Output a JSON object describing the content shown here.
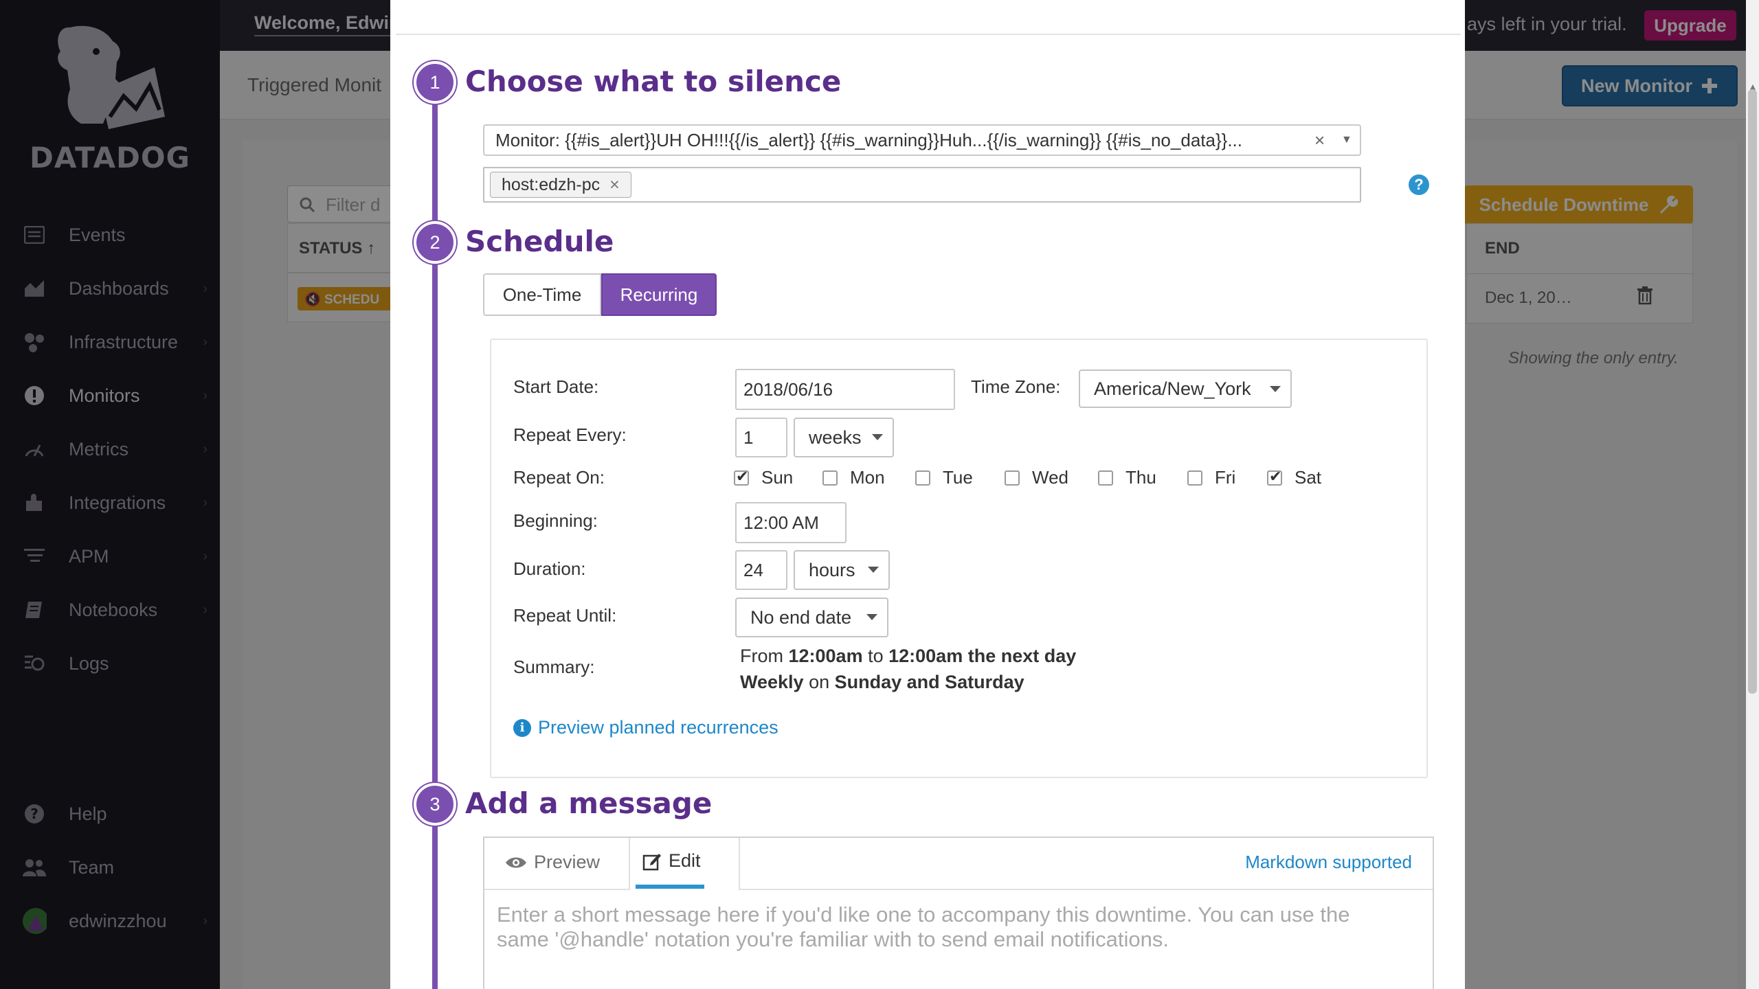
{
  "app": {
    "brand": "DATADOG",
    "welcome": "Welcome, Edwin",
    "trial_text": "ays left in your trial.",
    "upgrade_label": "Upgrade"
  },
  "sidebar": {
    "items": [
      {
        "label": "Events",
        "icon": "events-icon"
      },
      {
        "label": "Dashboards",
        "icon": "dashboards-icon",
        "chevron": "›"
      },
      {
        "label": "Infrastructure",
        "icon": "infrastructure-icon",
        "chevron": "›"
      },
      {
        "label": "Monitors",
        "icon": "monitors-icon",
        "chevron": "›"
      },
      {
        "label": "Metrics",
        "icon": "metrics-icon",
        "chevron": "›"
      },
      {
        "label": "Integrations",
        "icon": "integrations-icon",
        "chevron": "›"
      },
      {
        "label": "APM",
        "icon": "apm-icon",
        "chevron": "›"
      },
      {
        "label": "Notebooks",
        "icon": "notebooks-icon",
        "chevron": "›"
      },
      {
        "label": "Logs",
        "icon": "logs-icon"
      }
    ],
    "bottom": [
      {
        "label": "Help",
        "icon": "help-icon"
      },
      {
        "label": "Team",
        "icon": "team-icon"
      },
      {
        "label": "edwinzzhou",
        "icon": "avatar",
        "chevron": "›"
      }
    ]
  },
  "background_page": {
    "breadcrumb": "Triggered Monit",
    "new_monitor_label": "New Monitor",
    "filter_placeholder": "Filter d",
    "status_header": "STATUS",
    "status_sort": "↑",
    "status_pill": "SCHEDU",
    "schedule_downtime_label": "Schedule Downtime",
    "end_header": "END",
    "end_value": "Dec 1, 20…",
    "only_entry": "Showing the only entry."
  },
  "modal": {
    "steps": [
      {
        "number": "1",
        "title": "Choose what to silence"
      },
      {
        "number": "2",
        "title": "Schedule"
      },
      {
        "number": "3",
        "title": "Add a message"
      }
    ],
    "monitor_select": "Monitor: {{#is_alert}}UH OH!!!{{/is_alert}} {{#is_warning}}Huh...{{/is_warning}} {{#is_no_data}}...",
    "clear_symbol": "×",
    "tags": [
      "host:edzh-pc"
    ],
    "tag_remove": "×",
    "help_symbol": "?",
    "schedule_tabs": {
      "one_time": "One-Time",
      "recurring": "Recurring"
    },
    "form": {
      "start_date_label": "Start Date:",
      "start_date_value": "2018/06/16",
      "timezone_label": "Time Zone:",
      "timezone_value": "America/New_York",
      "repeat_every_label": "Repeat Every:",
      "repeat_every_value": "1",
      "repeat_every_unit": "weeks",
      "repeat_on_label": "Repeat On:",
      "days": [
        {
          "label": "Sun",
          "checked": true
        },
        {
          "label": "Mon",
          "checked": false
        },
        {
          "label": "Tue",
          "checked": false
        },
        {
          "label": "Wed",
          "checked": false
        },
        {
          "label": "Thu",
          "checked": false
        },
        {
          "label": "Fri",
          "checked": false
        },
        {
          "label": "Sat",
          "checked": true
        }
      ],
      "beginning_label": "Beginning:",
      "beginning_value": "12:00 AM",
      "duration_label": "Duration:",
      "duration_value": "24",
      "duration_unit": "hours",
      "repeat_until_label": "Repeat Until:",
      "repeat_until_value": "No end date",
      "summary_label": "Summary:",
      "summary_line1": {
        "pre": "From ",
        "start": "12:00am",
        "mid": " to ",
        "end": "12:00am the next day"
      },
      "summary_line2": {
        "freq": "Weekly",
        "mid": " on ",
        "days": "Sunday and Saturday"
      },
      "preview_link": "Preview planned recurrences",
      "info_symbol": "i"
    },
    "message": {
      "preview_tab": "Preview",
      "edit_tab": "Edit",
      "markdown_link": "Markdown supported",
      "placeholder": "Enter a short message here if you'd like one to accompany this downtime. You can use the same '@handle' notation you're familiar with to send email notifications."
    }
  },
  "colors": {
    "sidebar_bg": "#1c1a23",
    "accent_purple": "#7b4fb0",
    "link_blue": "#1e87c8",
    "upgrade_pink": "#c2187a",
    "new_monitor_blue": "#2a6fa8",
    "schedule_orange": "#f0ad1e"
  }
}
